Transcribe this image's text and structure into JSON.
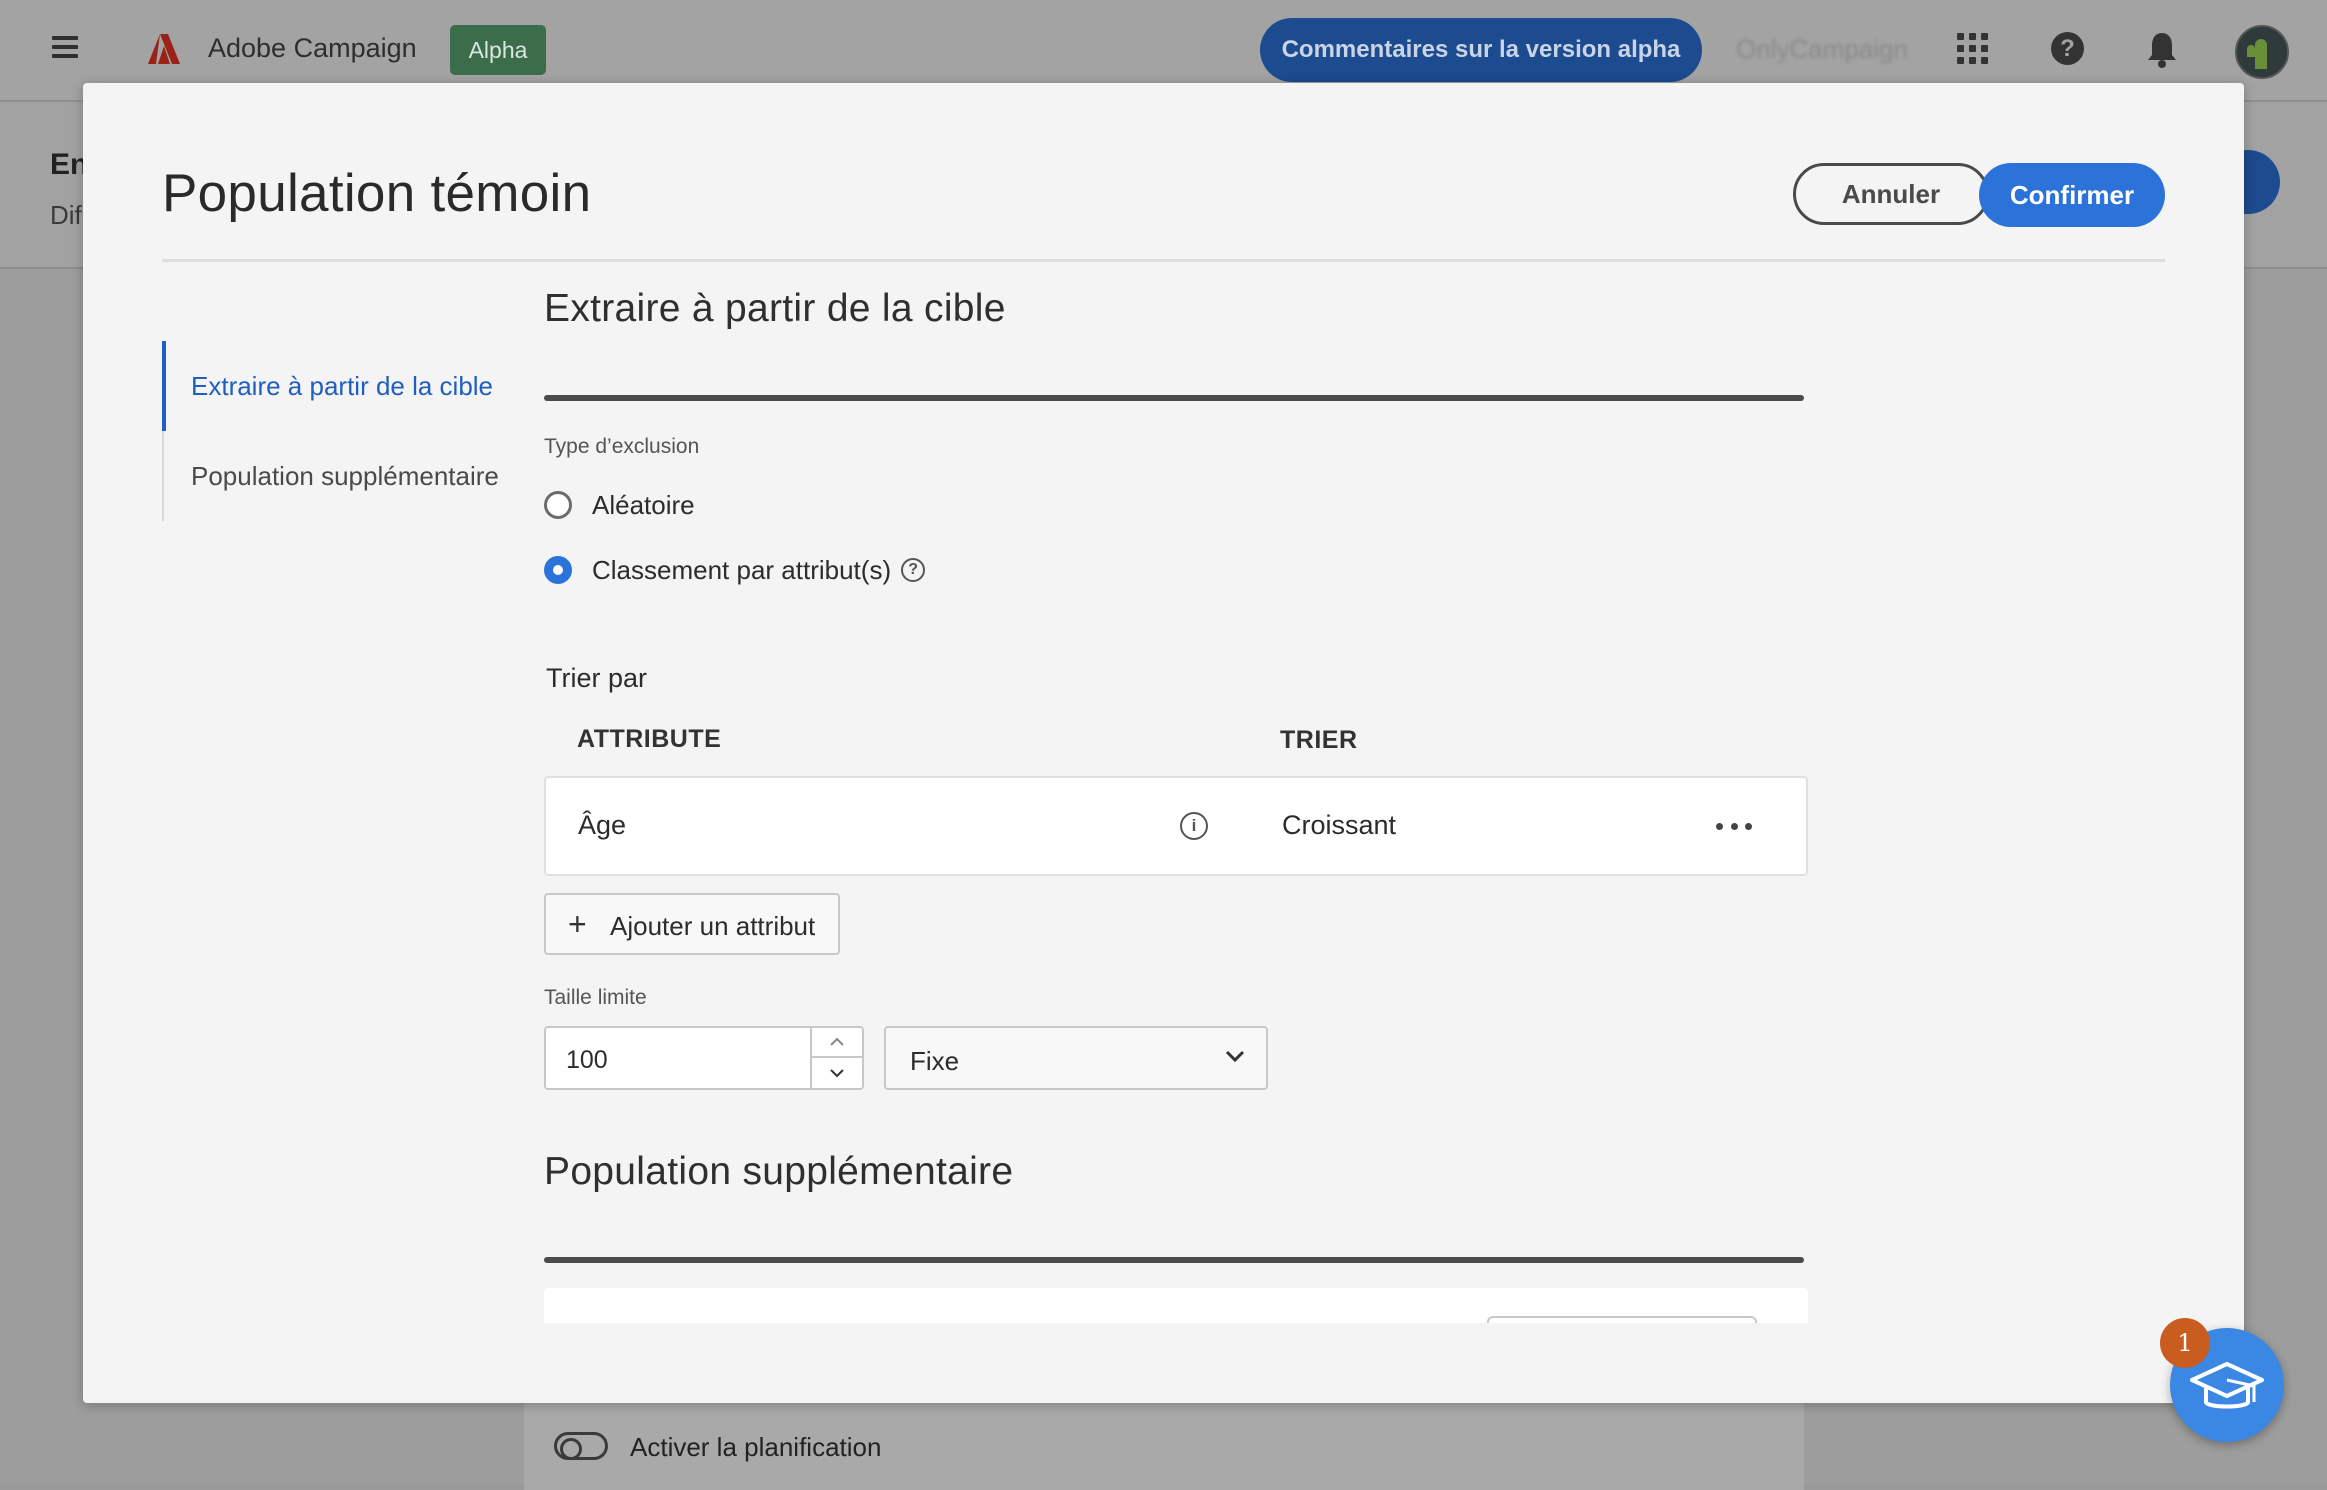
{
  "topbar": {
    "app_name": "Adobe Campaign",
    "alpha_badge": "Alpha",
    "feedback_button": "Commentaires sur la version alpha",
    "org_name": "OnlyCampaign"
  },
  "background_page": {
    "title_fragment": "En",
    "subtitle_fragment": "Dif",
    "schedule_toggle_label": "Activer la planification",
    "schedule_toggle_on": false
  },
  "modal": {
    "title": "Population témoin",
    "cancel_label": "Annuler",
    "confirm_label": "Confirmer",
    "nav": [
      {
        "label": "Extraire à partir de la cible",
        "active": true
      },
      {
        "label": "Population supplémentaire",
        "active": false
      }
    ],
    "extract_section": {
      "title": "Extraire à partir de la cible",
      "exclusion_label": "Type d’exclusion",
      "options": [
        {
          "label": "Aléatoire",
          "checked": false
        },
        {
          "label": "Classement par attribut(s)",
          "checked": true
        }
      ],
      "sort_title": "Trier par",
      "col_attribute": "ATTRIBUTE",
      "col_sort": "TRIER",
      "rows": [
        {
          "attribute": "Âge",
          "sort": "Croissant"
        }
      ],
      "add_attribute_label": "Ajouter un attribut",
      "limit_label": "Taille limite",
      "limit_value": "100",
      "limit_type": "Fixe"
    },
    "additional_section": {
      "title": "Population supplémentaire"
    }
  },
  "learn_badge_count": "1",
  "colors": {
    "accent": "#2b73d9",
    "nav_active": "#1f5fbf",
    "badge": "#c85d1f"
  }
}
